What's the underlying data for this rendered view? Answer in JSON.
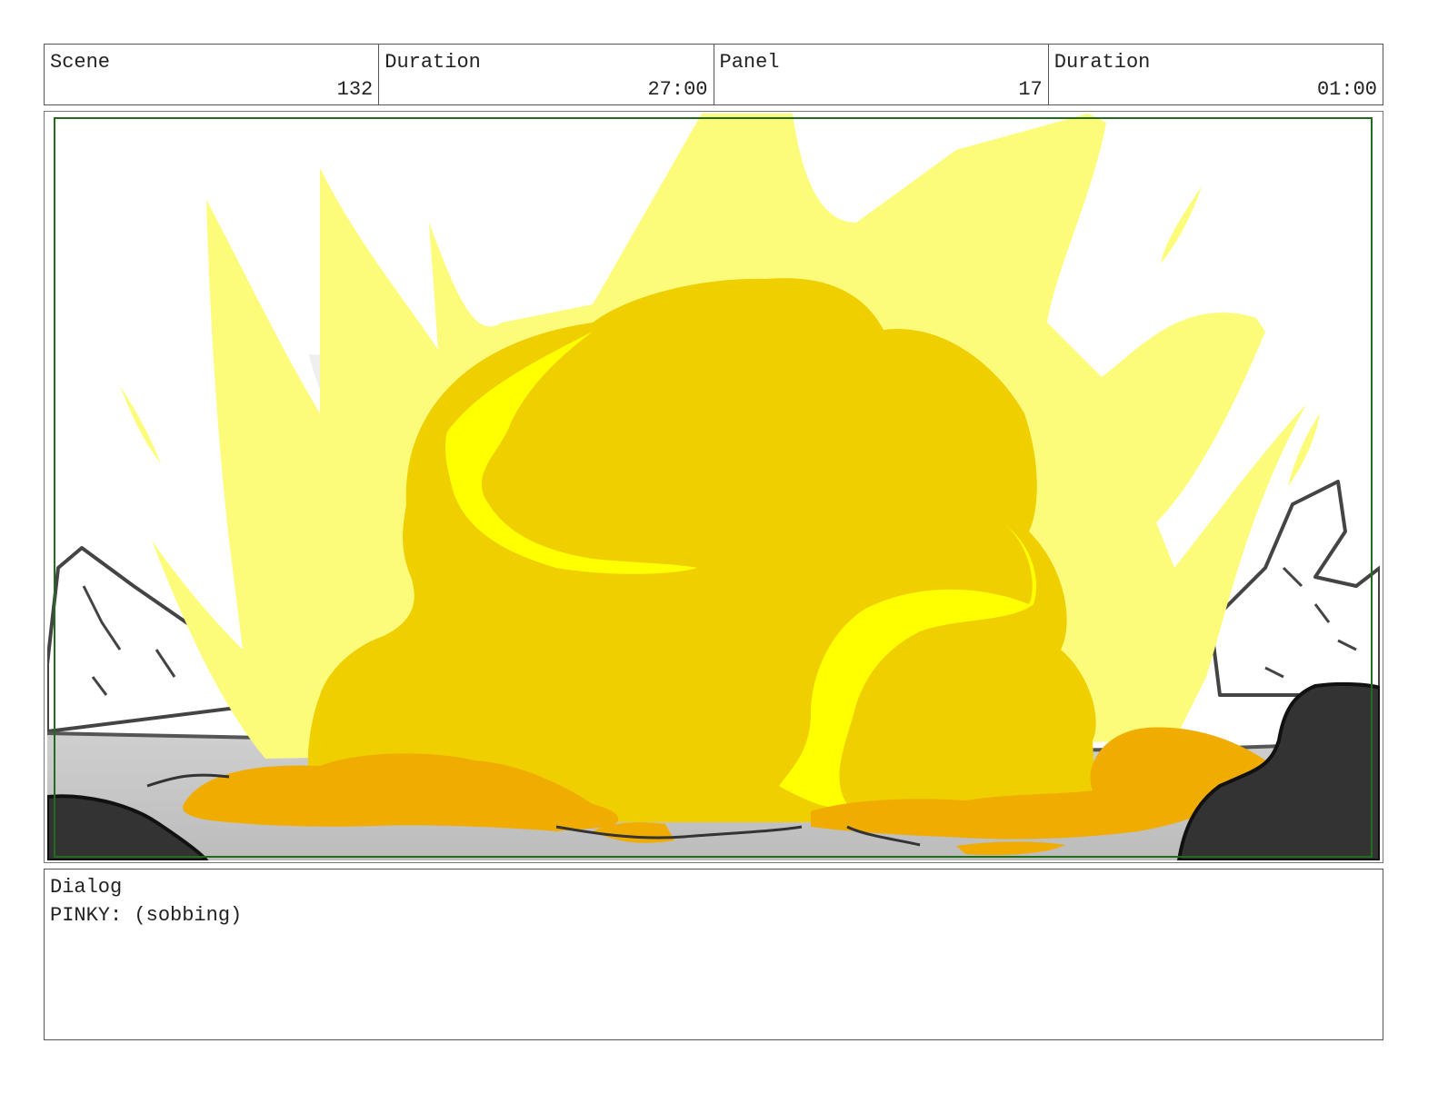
{
  "header": {
    "scene_label": "Scene",
    "scene_value": "132",
    "scene_duration_label": "Duration",
    "scene_duration_value": "27:00",
    "panel_label": "Panel",
    "panel_value": "17",
    "panel_duration_label": "Duration",
    "panel_duration_value": "01:00"
  },
  "panel": {
    "safe_frame_color": "#1e6e1e",
    "explosion_colors": [
      "#fdfc7a",
      "#f0cf00",
      "#ffff00",
      "#f0ad00"
    ]
  },
  "dialog": {
    "label": "Dialog",
    "text": "PINKY: (sobbing)"
  }
}
